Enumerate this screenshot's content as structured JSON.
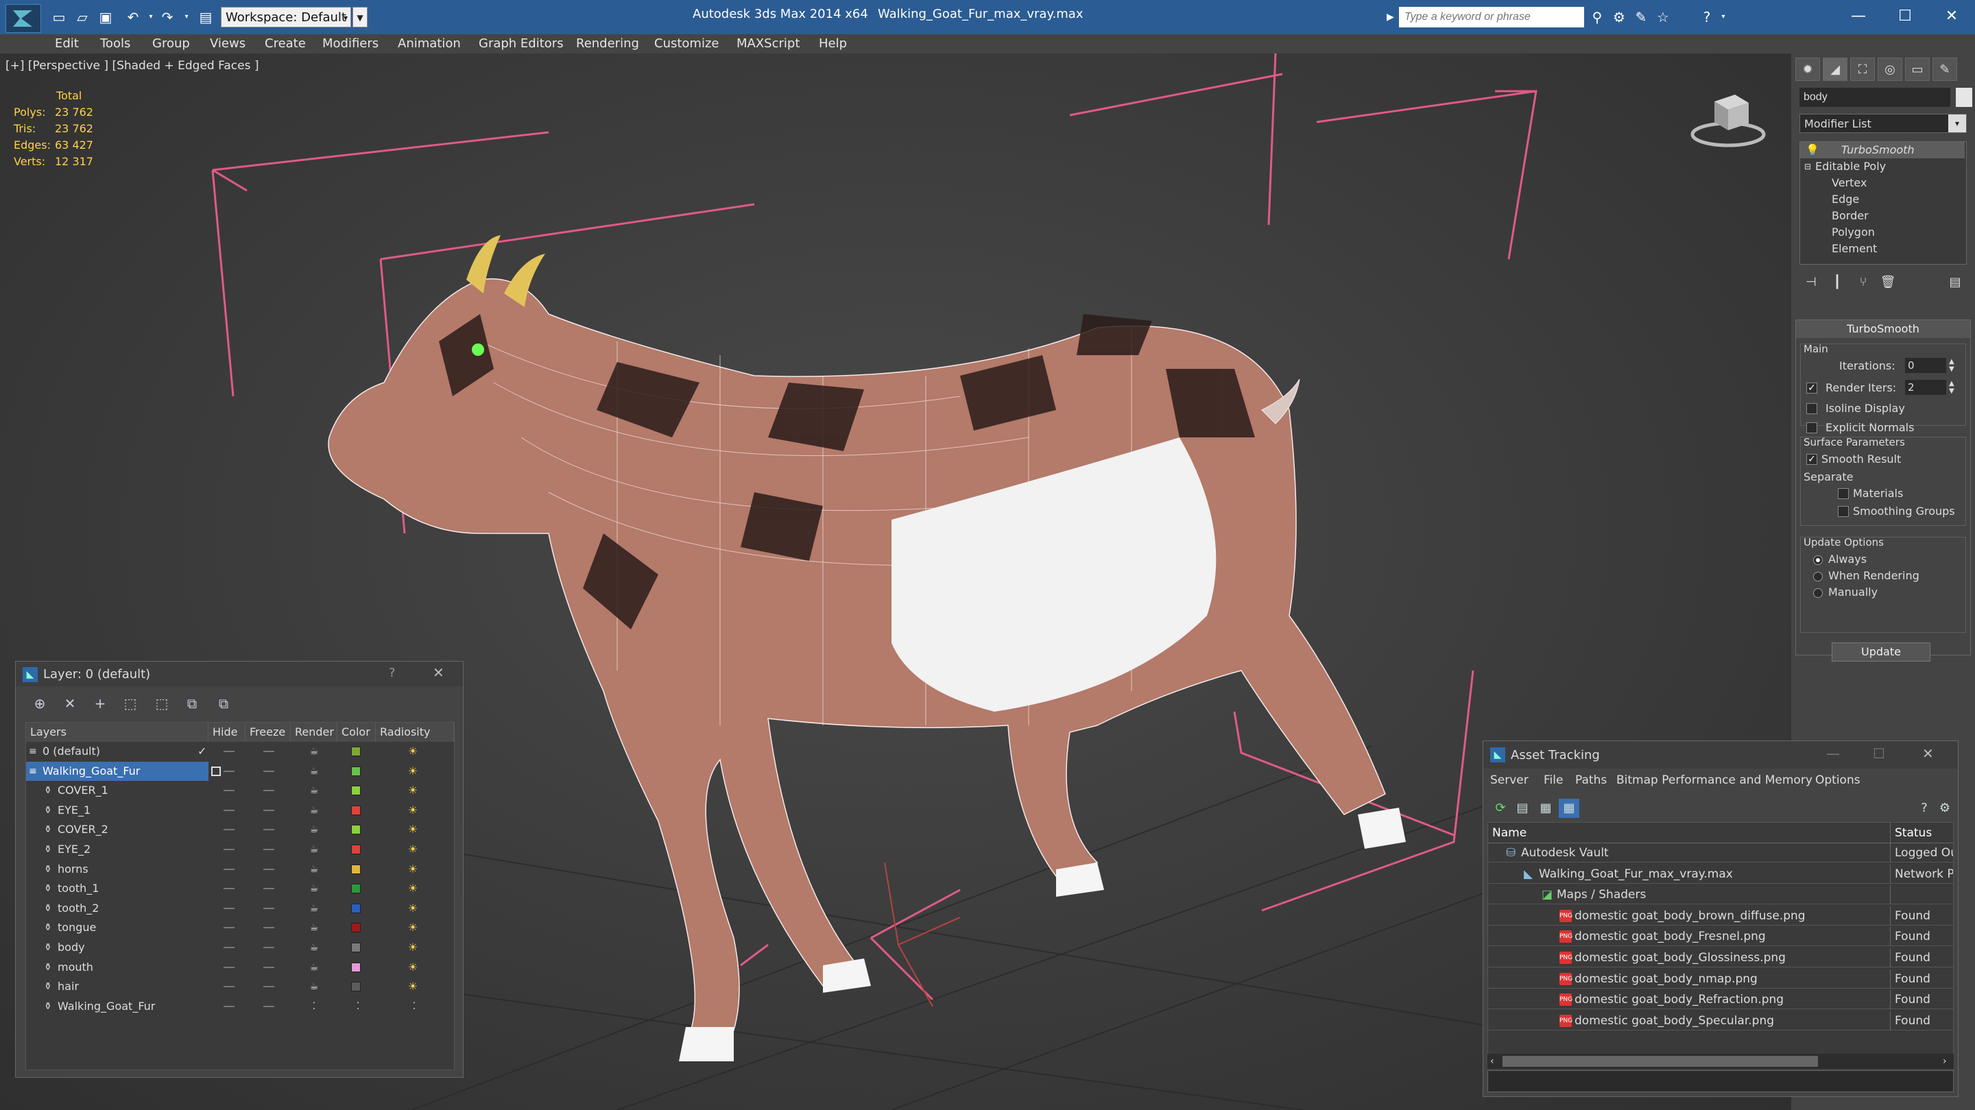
{
  "titlebar": {
    "app_title": "Autodesk 3ds Max  2014 x64",
    "file_title": "Walking_Goat_Fur_max_vray.max",
    "workspace_label": "Workspace: Default",
    "search_placeholder": "Type a keyword or phrase",
    "accent_color": "#2b5c94"
  },
  "menu": {
    "items": [
      "Edit",
      "Tools",
      "Group",
      "Views",
      "Create",
      "Modifiers",
      "Animation",
      "Graph Editors",
      "Rendering",
      "Customize",
      "MAXScript",
      "Help"
    ]
  },
  "viewport": {
    "label": "[+] [Perspective ] [Shaded + Edged Faces ]",
    "stats": {
      "header": "Total",
      "rows": [
        {
          "label": "Polys:",
          "value": "23 762"
        },
        {
          "label": "Tris:",
          "value": "23 762"
        },
        {
          "label": "Edges:",
          "value": "63 427"
        },
        {
          "label": "Verts:",
          "value": "12 317"
        }
      ]
    }
  },
  "command_panel": {
    "object_name": "body",
    "modifier_list": "Modifier List",
    "stack": {
      "top": "TurboSmooth",
      "base": "Editable Poly",
      "subobjects": [
        "Vertex",
        "Edge",
        "Border",
        "Polygon",
        "Element"
      ]
    },
    "rollout": {
      "title": "TurboSmooth",
      "main_group": "Main",
      "iterations_label": "Iterations:",
      "iterations_value": "0",
      "render_iters_label": "Render Iters:",
      "render_iters_value": "2",
      "isoline_label": "Isoline Display",
      "explicit_normals_label": "Explicit Normals",
      "surface_group": "Surface Parameters",
      "smooth_result_label": "Smooth Result",
      "separate_label": "Separate",
      "materials_label": "Materials",
      "smoothing_groups_label": "Smoothing Groups",
      "update_group": "Update Options",
      "always_label": "Always",
      "when_rendering_label": "When Rendering",
      "manually_label": "Manually",
      "update_button": "Update"
    }
  },
  "layer_window": {
    "title": "Layer: 0 (default)",
    "help": "?",
    "columns": [
      "Layers",
      "Hide",
      "Freeze",
      "Render",
      "Color",
      "Radiosity"
    ],
    "rows": [
      {
        "name": "0 (default)",
        "color": "#7fa832",
        "level": 0,
        "active": true
      },
      {
        "name": "Walking_Goat_Fur",
        "color": "#66c24a",
        "level": 0,
        "selected": true
      },
      {
        "name": "COVER_1",
        "color": "#8bd13a",
        "level": 1
      },
      {
        "name": "EYE_1",
        "color": "#e0433a",
        "level": 1
      },
      {
        "name": "COVER_2",
        "color": "#8bd13a",
        "level": 1
      },
      {
        "name": "EYE_2",
        "color": "#e0433a",
        "level": 1
      },
      {
        "name": "horns",
        "color": "#e0b640",
        "level": 1
      },
      {
        "name": "tooth_1",
        "color": "#2a9a3a",
        "level": 1
      },
      {
        "name": "tooth_2",
        "color": "#2a5fc2",
        "level": 1
      },
      {
        "name": "tongue",
        "color": "#a01818",
        "level": 1
      },
      {
        "name": "body",
        "color": "#7a7a7a",
        "level": 1
      },
      {
        "name": "mouth",
        "color": "#e39bd8",
        "level": 1
      },
      {
        "name": "hair",
        "color": "#5c5c5c",
        "level": 1
      },
      {
        "name": "Walking_Goat_Fur",
        "color": "",
        "level": 1
      }
    ]
  },
  "asset_window": {
    "title": "Asset Tracking",
    "menu": [
      "Server",
      "File",
      "Paths",
      "Bitmap Performance and Memory",
      "Options"
    ],
    "columns": [
      "Name",
      "Status"
    ],
    "rows": [
      {
        "name": "Autodesk Vault",
        "status": "Logged Ou",
        "level": 0
      },
      {
        "name": "Walking_Goat_Fur_max_vray.max",
        "status": "Network P",
        "level": 1
      },
      {
        "name": "Maps / Shaders",
        "status": "",
        "level": 2
      },
      {
        "name": "domestic goat_body_brown_diffuse.png",
        "status": "Found",
        "level": 3
      },
      {
        "name": "domestic goat_body_Fresnel.png",
        "status": "Found",
        "level": 3
      },
      {
        "name": "domestic goat_body_Glossiness.png",
        "status": "Found",
        "level": 3
      },
      {
        "name": "domestic goat_body_nmap.png",
        "status": "Found",
        "level": 3
      },
      {
        "name": "domestic goat_body_Refraction.png",
        "status": "Found",
        "level": 3
      },
      {
        "name": "domestic goat_body_Specular.png",
        "status": "Found",
        "level": 3
      }
    ]
  }
}
